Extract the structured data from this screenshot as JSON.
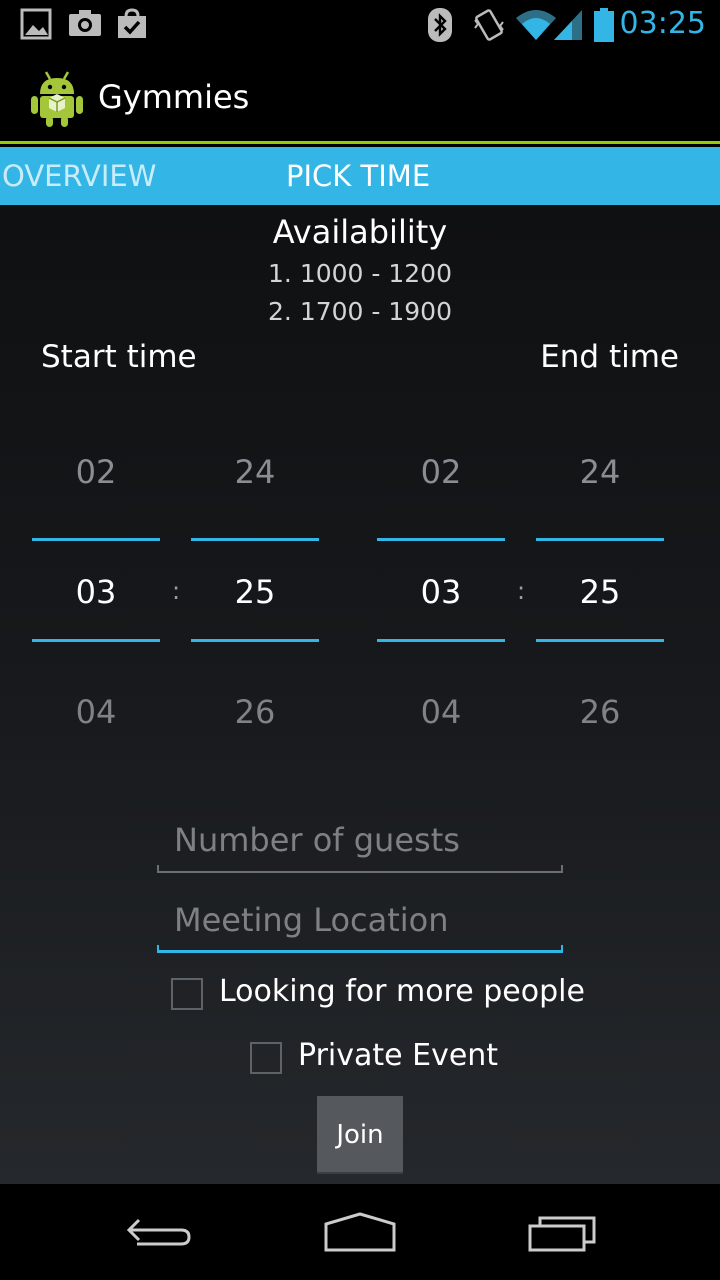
{
  "status_bar": {
    "time": "03:25",
    "icons": [
      "image-icon",
      "camera-icon",
      "shopping-bag-check-icon",
      "bluetooth-icon",
      "vibrate-icon",
      "wifi-icon",
      "signal-icon",
      "battery-icon"
    ]
  },
  "app": {
    "title": "Gymmies",
    "icon": "android-robot-icon"
  },
  "tabs": [
    {
      "label": "OVERVIEW",
      "selected": false
    },
    {
      "label": "PICK TIME",
      "selected": true
    }
  ],
  "availability": {
    "title": "Availability",
    "slots": [
      "1. 1000 - 1200",
      "2. 1700 - 1900"
    ]
  },
  "start_time": {
    "label": "Start time",
    "hour": {
      "prev": "02",
      "current": "03",
      "next": "04"
    },
    "minute": {
      "prev": "24",
      "current": "25",
      "next": "26"
    },
    "separator": ":"
  },
  "end_time": {
    "label": "End time",
    "hour": {
      "prev": "02",
      "current": "03",
      "next": "04"
    },
    "minute": {
      "prev": "24",
      "current": "25",
      "next": "26"
    },
    "separator": ":"
  },
  "form": {
    "guests_placeholder": "Number of guests",
    "location_placeholder": "Meeting Location",
    "more_people_label": "Looking for more people",
    "more_people_checked": false,
    "private_label": "Private Event",
    "private_checked": false,
    "join_label": "Join"
  },
  "colors": {
    "accent": "#33b5e5",
    "actionbar_divider": "#99cc00"
  }
}
